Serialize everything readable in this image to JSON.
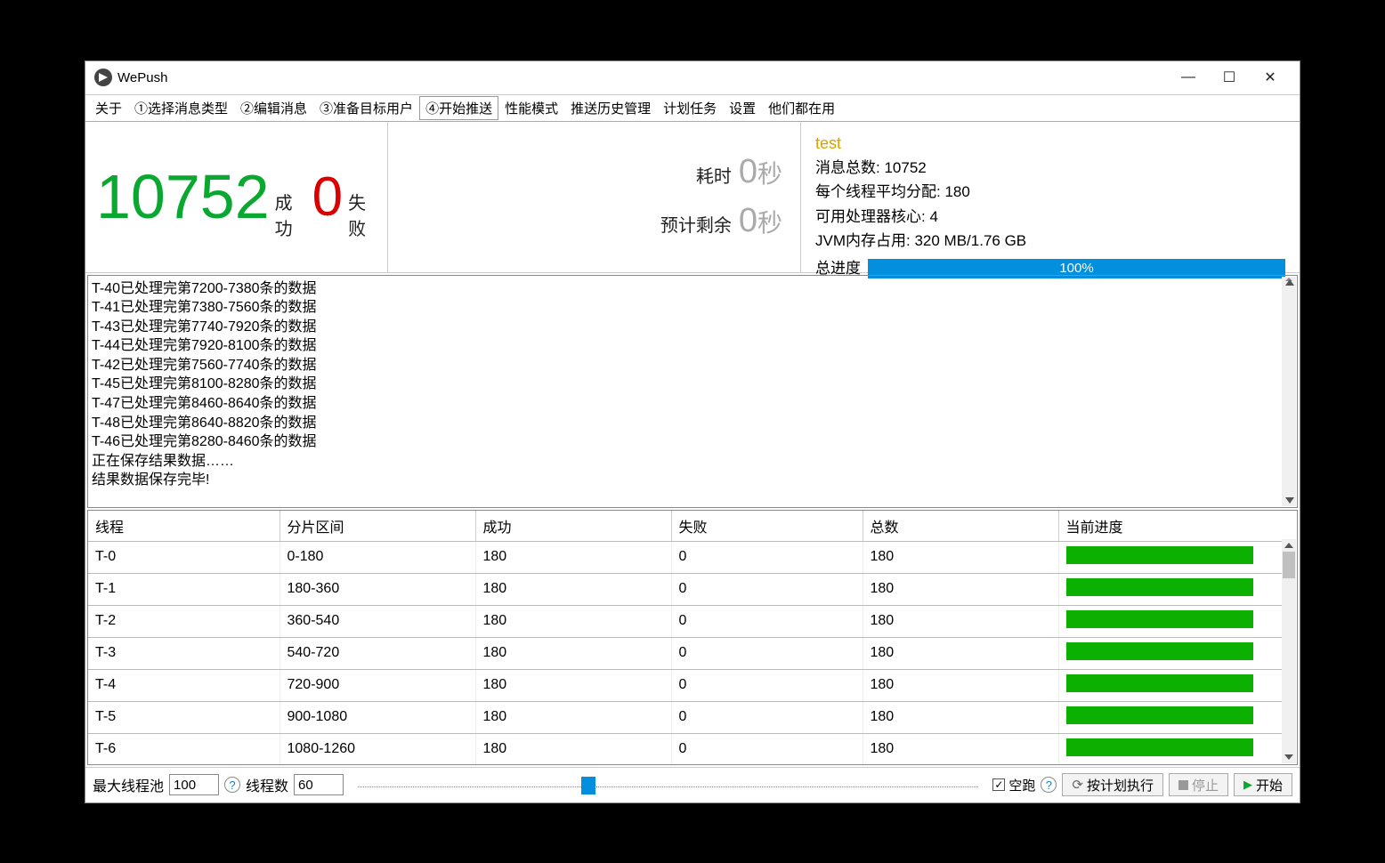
{
  "window": {
    "title": "WePush"
  },
  "tabs": [
    "关于",
    "①选择消息类型",
    "②编辑消息",
    "③准备目标用户",
    "④开始推送",
    "性能模式",
    "推送历史管理",
    "计划任务",
    "设置",
    "他们都在用"
  ],
  "active_tab_index": 4,
  "counters": {
    "success_value": "10752",
    "success_label": "成功",
    "fail_value": "0",
    "fail_label": "失败"
  },
  "mid": {
    "elapsed_label": "耗时",
    "elapsed_value": "0",
    "elapsed_unit": "秒",
    "remain_label": "预计剩余",
    "remain_value": "0",
    "remain_unit": "秒"
  },
  "info": {
    "test_name": "test",
    "msg_total_label": "消息总数:",
    "msg_total_value": "10752",
    "per_thread_label": "每个线程平均分配:",
    "per_thread_value": "180",
    "cores_label": "可用处理器核心:",
    "cores_value": "4",
    "jvm_label": "JVM内存占用:",
    "jvm_value": "320 MB/1.76 GB",
    "overall_label": "总进度",
    "overall_pct": "100%"
  },
  "log_lines": [
    "T-40已处理完第7200-7380条的数据",
    "T-41已处理完第7380-7560条的数据",
    "T-43已处理完第7740-7920条的数据",
    "T-44已处理完第7920-8100条的数据",
    "T-42已处理完第7560-7740条的数据",
    "T-45已处理完第8100-8280条的数据",
    "T-47已处理完第8460-8640条的数据",
    "T-48已处理完第8640-8820条的数据",
    "T-46已处理完第8280-8460条的数据",
    "正在保存结果数据……",
    "结果数据保存完毕!"
  ],
  "table": {
    "headers": [
      "线程",
      "分片区间",
      "成功",
      "失败",
      "总数",
      "当前进度"
    ],
    "rows": [
      {
        "thread": "T-0",
        "range": "0-180",
        "success": "180",
        "fail": "0",
        "total": "180"
      },
      {
        "thread": "T-1",
        "range": "180-360",
        "success": "180",
        "fail": "0",
        "total": "180"
      },
      {
        "thread": "T-2",
        "range": "360-540",
        "success": "180",
        "fail": "0",
        "total": "180"
      },
      {
        "thread": "T-3",
        "range": "540-720",
        "success": "180",
        "fail": "0",
        "total": "180"
      },
      {
        "thread": "T-4",
        "range": "720-900",
        "success": "180",
        "fail": "0",
        "total": "180"
      },
      {
        "thread": "T-5",
        "range": "900-1080",
        "success": "180",
        "fail": "0",
        "total": "180"
      },
      {
        "thread": "T-6",
        "range": "1080-1260",
        "success": "180",
        "fail": "0",
        "total": "180"
      }
    ]
  },
  "footer": {
    "max_pool_label": "最大线程池",
    "max_pool_value": "100",
    "thread_count_label": "线程数",
    "thread_count_value": "60",
    "dryrun_label": "空跑",
    "schedule_label": "按计划执行",
    "stop_label": "停止",
    "start_label": "开始"
  }
}
